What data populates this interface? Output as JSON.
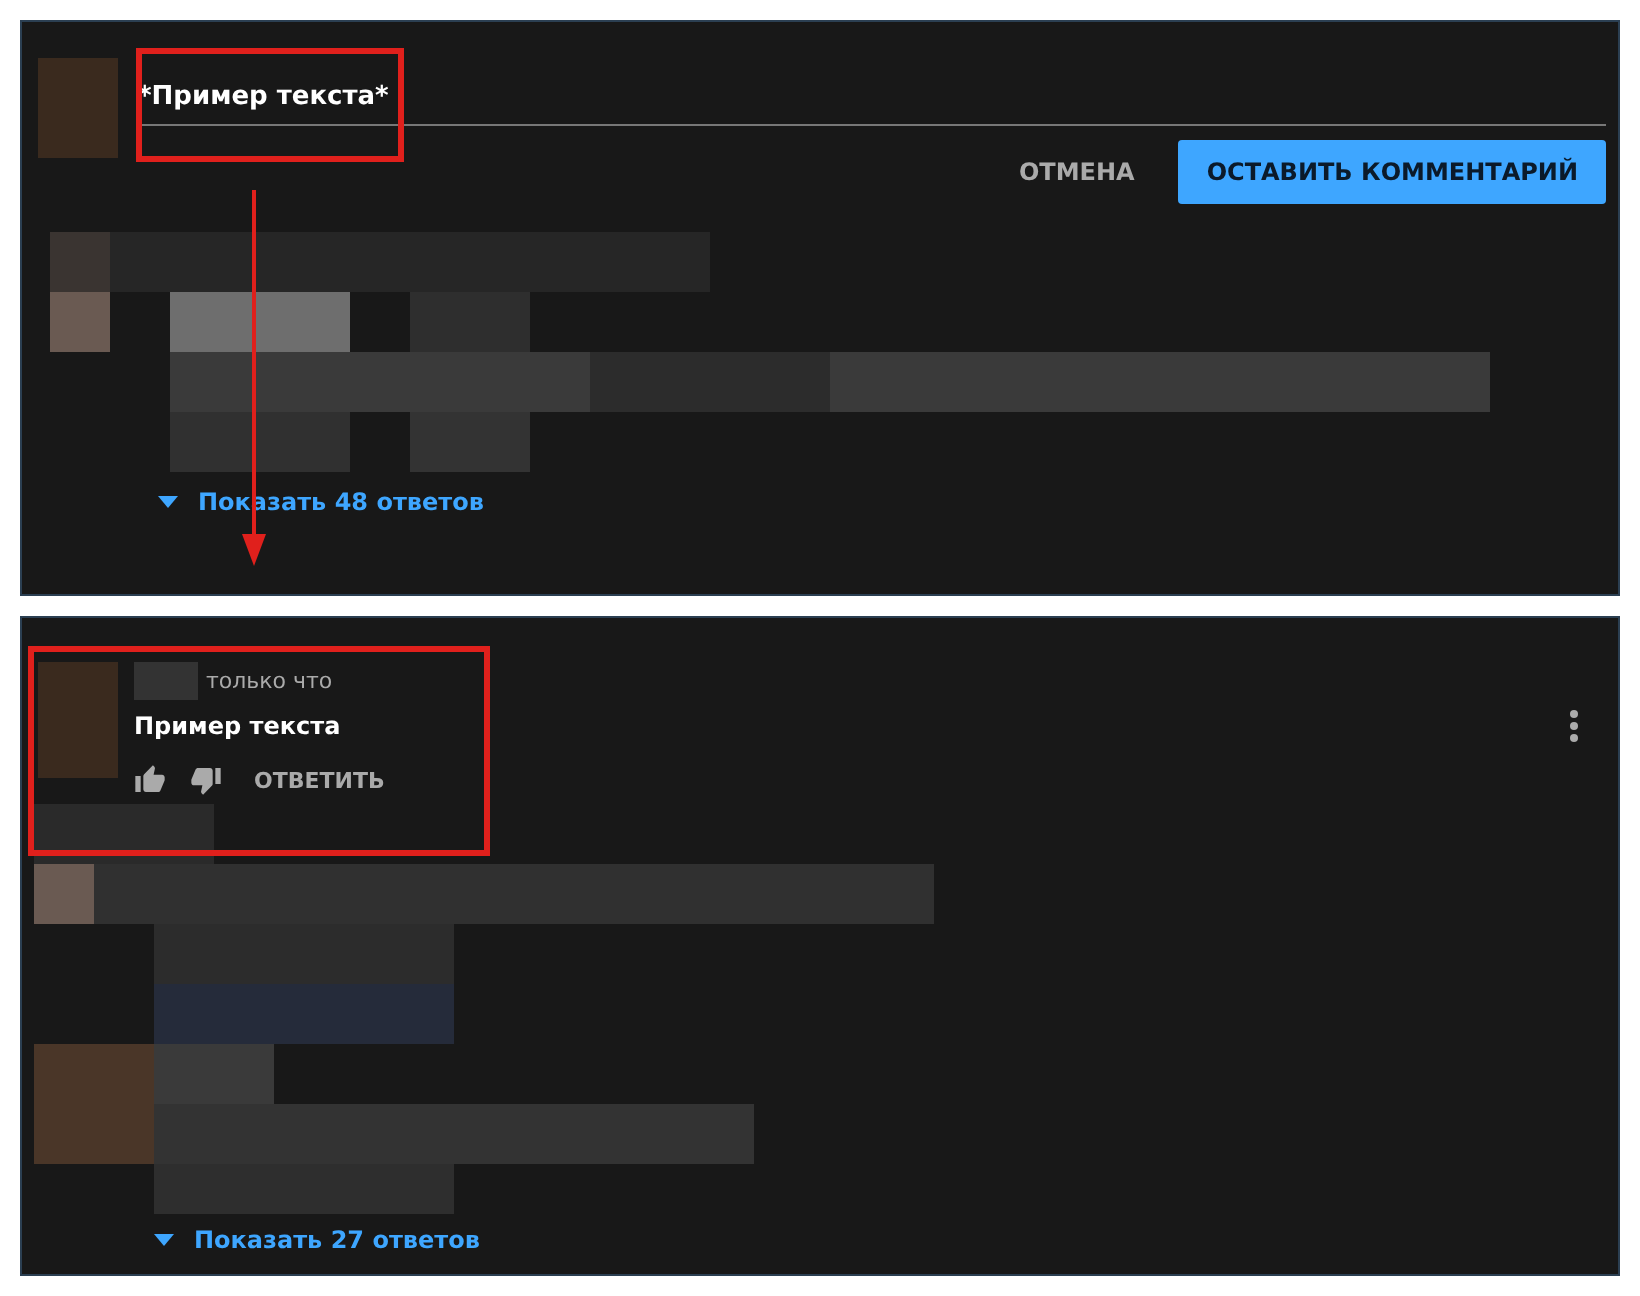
{
  "composer": {
    "value": "*Пример текста*",
    "cancel_label": "ОТМЕНА",
    "submit_label": "ОСТАВИТЬ КОММЕНТАРИЙ"
  },
  "thread_1": {
    "replies_link": "Показать 48 ответов"
  },
  "comment": {
    "time": "только что",
    "text": "Пример текста",
    "reply_label": "ОТВЕТИТЬ"
  },
  "thread_2": {
    "replies_link": "Показать 27 ответов"
  }
}
